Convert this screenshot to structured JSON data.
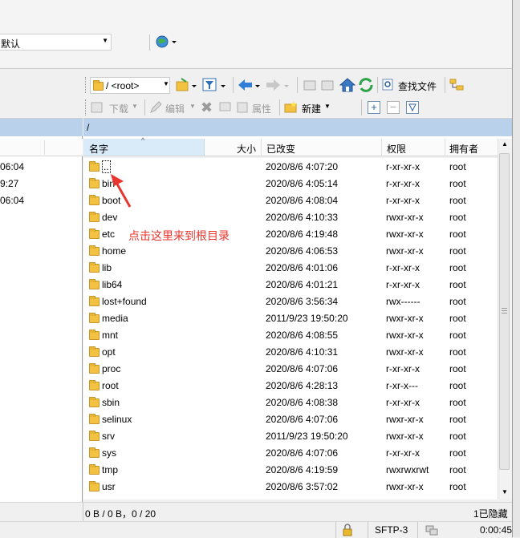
{
  "top": {
    "session_select": "默认"
  },
  "toolbar2": {
    "path_combo": "/ <root>",
    "find_files": "查找文件"
  },
  "toolbar3": {
    "download": "下载",
    "edit": "编辑",
    "properties": "属性",
    "new": "新建"
  },
  "remote": {
    "path": "/",
    "columns": {
      "name": "名字",
      "size": "大小",
      "modified": "已改变",
      "perms": "权限",
      "owner": "拥有者"
    },
    "rows": [
      {
        "name": "..",
        "modified": "2020/8/6 4:07:20",
        "perms": "r-xr-xr-x",
        "owner": "root"
      },
      {
        "name": "bin",
        "modified": "2020/8/6 4:05:14",
        "perms": "r-xr-xr-x",
        "owner": "root"
      },
      {
        "name": "boot",
        "modified": "2020/8/6 4:08:04",
        "perms": "r-xr-xr-x",
        "owner": "root"
      },
      {
        "name": "dev",
        "modified": "2020/8/6 4:10:33",
        "perms": "rwxr-xr-x",
        "owner": "root"
      },
      {
        "name": "etc",
        "modified": "2020/8/6 4:19:48",
        "perms": "rwxr-xr-x",
        "owner": "root"
      },
      {
        "name": "home",
        "modified": "2020/8/6 4:06:53",
        "perms": "rwxr-xr-x",
        "owner": "root"
      },
      {
        "name": "lib",
        "modified": "2020/8/6 4:01:06",
        "perms": "r-xr-xr-x",
        "owner": "root"
      },
      {
        "name": "lib64",
        "modified": "2020/8/6 4:01:21",
        "perms": "r-xr-xr-x",
        "owner": "root"
      },
      {
        "name": "lost+found",
        "modified": "2020/8/6 3:56:34",
        "perms": "rwx------",
        "owner": "root"
      },
      {
        "name": "media",
        "modified": "2011/9/23 19:50:20",
        "perms": "rwxr-xr-x",
        "owner": "root"
      },
      {
        "name": "mnt",
        "modified": "2020/8/6 4:08:55",
        "perms": "rwxr-xr-x",
        "owner": "root"
      },
      {
        "name": "opt",
        "modified": "2020/8/6 4:10:31",
        "perms": "rwxr-xr-x",
        "owner": "root"
      },
      {
        "name": "proc",
        "modified": "2020/8/6 4:07:06",
        "perms": "r-xr-xr-x",
        "owner": "root"
      },
      {
        "name": "root",
        "modified": "2020/8/6 4:28:13",
        "perms": "r-xr-x---",
        "owner": "root"
      },
      {
        "name": "sbin",
        "modified": "2020/8/6 4:08:38",
        "perms": "r-xr-xr-x",
        "owner": "root"
      },
      {
        "name": "selinux",
        "modified": "2020/8/6 4:07:06",
        "perms": "rwxr-xr-x",
        "owner": "root"
      },
      {
        "name": "srv",
        "modified": "2011/9/23 19:50:20",
        "perms": "rwxr-xr-x",
        "owner": "root"
      },
      {
        "name": "sys",
        "modified": "2020/8/6 4:07:06",
        "perms": "r-xr-xr-x",
        "owner": "root"
      },
      {
        "name": "tmp",
        "modified": "2020/8/6 4:19:59",
        "perms": "rwxrwxrwt",
        "owner": "root"
      },
      {
        "name": "usr",
        "modified": "2020/8/6 3:57:02",
        "perms": "rwxr-xr-x",
        "owner": "root"
      }
    ]
  },
  "local": {
    "times": [
      "06:04",
      "9:27",
      "06:04"
    ]
  },
  "status": {
    "selection": "0 B / 0 B，0 / 20",
    "hidden": "1已隐藏",
    "protocol": "SFTP-3",
    "elapsed": "0:00:45"
  },
  "annotation": "点击这里来到根目录",
  "colors": {
    "path_bar": "#b9d1ea",
    "annotation_red": "#e8352e",
    "folder": "#f2c240"
  }
}
